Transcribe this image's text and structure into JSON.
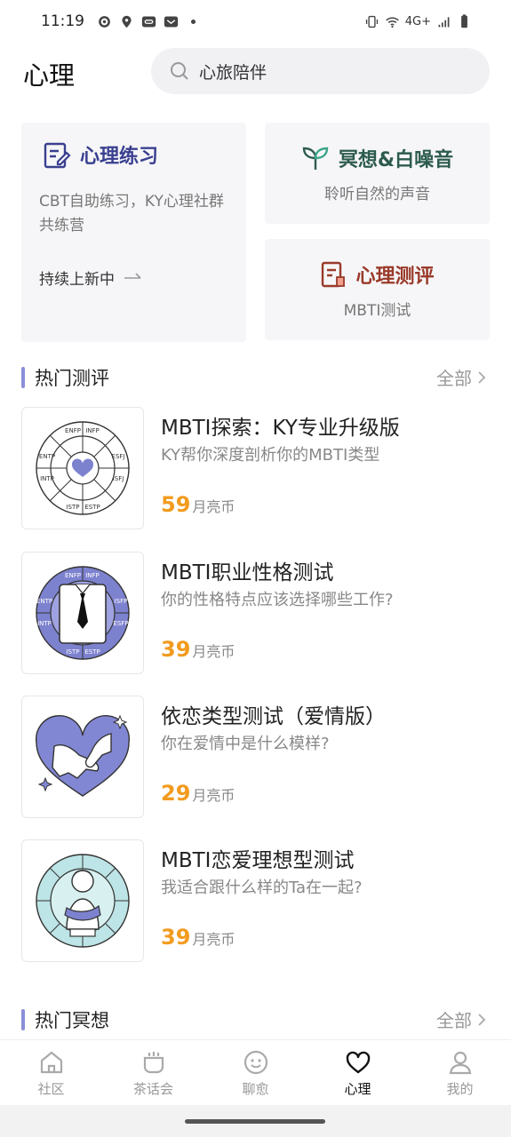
{
  "status_bar": {
    "time": "11:19",
    "network": "4G+",
    "left_icons": [
      "gear-icon",
      "location-icon",
      "link-icon",
      "message-icon",
      "dot-icon"
    ],
    "right_icons": [
      "vibrate-icon",
      "wifi-icon",
      "signal-icon",
      "battery-icon"
    ]
  },
  "header": {
    "title": "心理",
    "search_placeholder": "心旅陪伴"
  },
  "features": {
    "practice": {
      "title": "心理练习",
      "desc": "CBT自助练习，KY心理社群共练营",
      "more": "持续上新中"
    },
    "meditation": {
      "title": "冥想&白噪音",
      "sub": "聆听自然的声音"
    },
    "evaluation": {
      "title": "心理测评",
      "sub": "MBTI测试"
    }
  },
  "hot_tests": {
    "title": "热门测评",
    "all": "全部",
    "items": [
      {
        "title": "MBTI探索：KY专业升级版",
        "desc": "KY帮你深度剖析你的MBTI类型",
        "price": "59",
        "unit": "月亮币"
      },
      {
        "title": "MBTI职业性格测试",
        "desc": "你的性格特点应该选择哪些工作?",
        "price": "39",
        "unit": "月亮币"
      },
      {
        "title": "依恋类型测试（爱情版）",
        "desc": "你在爱情中是什么模样?",
        "price": "29",
        "unit": "月亮币"
      },
      {
        "title": "MBTI恋爱理想型测试",
        "desc": "我适合跟什么样的Ta在一起?",
        "price": "39",
        "unit": "月亮币"
      }
    ]
  },
  "hot_meditation": {
    "title": "热门冥想",
    "all": "全部"
  },
  "nav": {
    "items": [
      {
        "label": "社区",
        "icon": "home-icon"
      },
      {
        "label": "茶话会",
        "icon": "cup-icon"
      },
      {
        "label": "聊愈",
        "icon": "smile-icon"
      },
      {
        "label": "心理",
        "icon": "heart-icon",
        "active": true
      },
      {
        "label": "我的",
        "icon": "profile-icon"
      }
    ]
  },
  "colors": {
    "accent_purple": "#8b8fd8",
    "price_orange": "#f29b1f",
    "practice_blue": "#3a3f8f",
    "meditation_green": "#2d5b4d",
    "evaluation_red": "#9a3a2a"
  },
  "thumb_labels": {
    "mbti_wheel": [
      "ENFP",
      "INFP",
      "ESFJ",
      "ISFJ",
      "ESTP",
      "ISTP",
      "INTP",
      "ENTP"
    ],
    "career_wheel": [
      "ENFP",
      "INFP",
      "ISFP",
      "ESFP",
      "ESTP",
      "ISTP",
      "INTP",
      "ENTP"
    ]
  }
}
